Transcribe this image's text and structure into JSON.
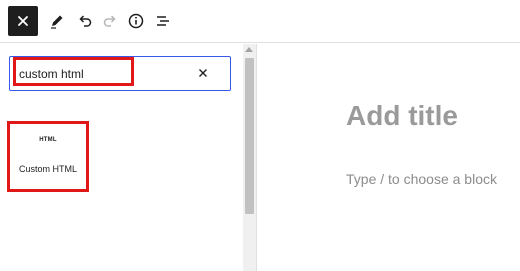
{
  "toolbar": {
    "close_icon": "close-icon",
    "tools": [
      "pencil-icon",
      "undo-icon",
      "redo-icon",
      "info-icon",
      "list-view-icon"
    ]
  },
  "inserter": {
    "search_value": "custom html",
    "clear_icon": "close-icon",
    "results": [
      {
        "icon_text": "HTML",
        "label": "Custom HTML"
      }
    ]
  },
  "editor": {
    "title_placeholder": "Add title",
    "block_placeholder": "Type / to choose a block"
  },
  "colors": {
    "highlight": "#e01818",
    "focus": "#3858e9",
    "toolbar_dark": "#1e1e1e",
    "placeholder": "#9a9a9a"
  }
}
